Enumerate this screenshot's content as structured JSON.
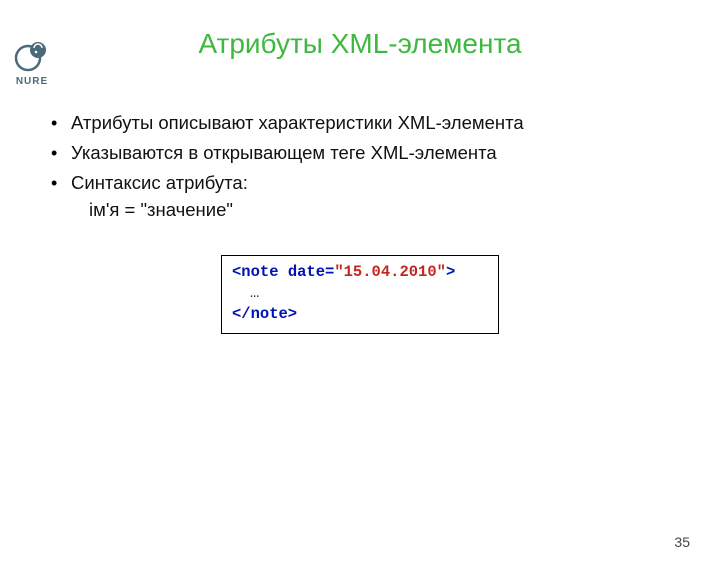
{
  "logo": {
    "text": "NURE"
  },
  "title": "Атрибуты XML-элемента",
  "bullets": [
    "Атрибуты описывают характеристики XML-элемента",
    "Указываются в открывающем теге XML-элемента",
    "Синтаксис атрибута:"
  ],
  "syntax_example": "ім'я = \"значение\"",
  "code": {
    "open_prefix": "<note ",
    "attr_name": "date=",
    "attr_value": "\"15.04.2010\"",
    "open_suffix": ">",
    "body": "…",
    "close": "</note>"
  },
  "page_number": "35"
}
